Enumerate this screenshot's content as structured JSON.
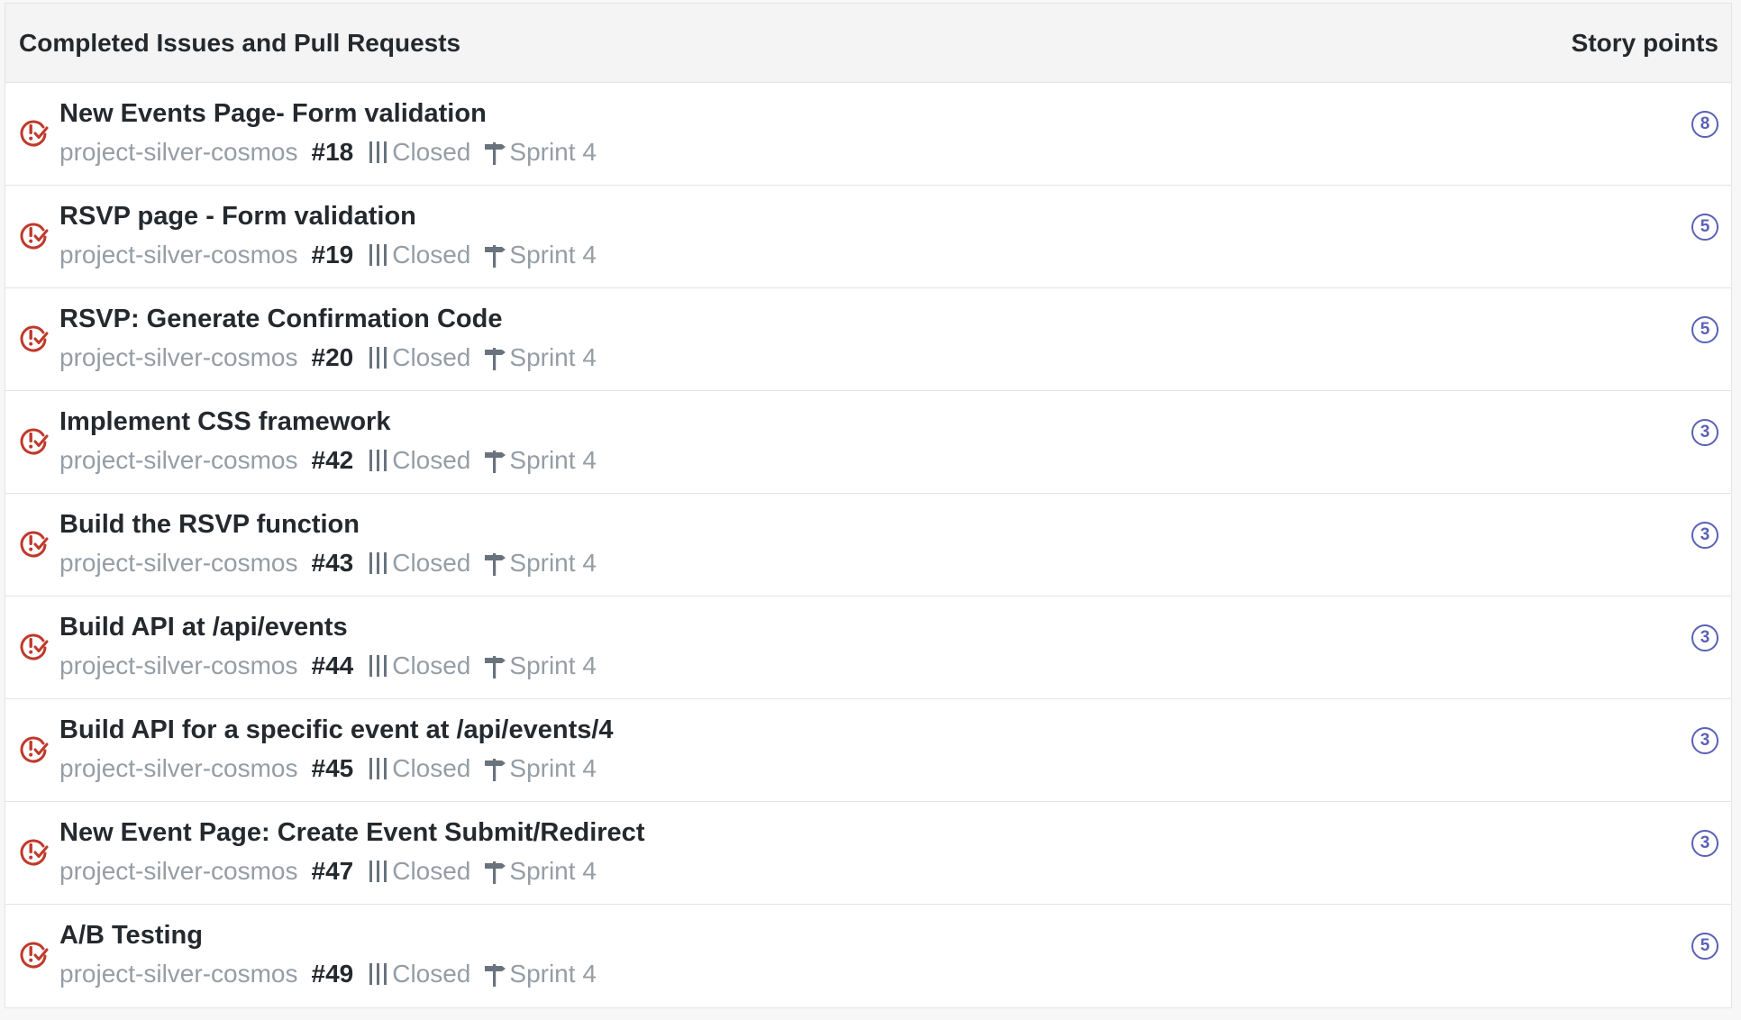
{
  "header": {
    "title": "Completed Issues and Pull Requests",
    "points_label": "Story points"
  },
  "colors": {
    "closed_icon": "#c0392b",
    "points_badge": "#5a61b6",
    "muted_text": "#959da5"
  },
  "issues": [
    {
      "title": "New Events Page- Form validation",
      "repo": "project-silver-cosmos",
      "number": "#18",
      "status": "Closed",
      "milestone": "Sprint 4",
      "points": "8"
    },
    {
      "title": "RSVP page - Form validation",
      "repo": "project-silver-cosmos",
      "number": "#19",
      "status": "Closed",
      "milestone": "Sprint 4",
      "points": "5"
    },
    {
      "title": "RSVP: Generate Confirmation Code",
      "repo": "project-silver-cosmos",
      "number": "#20",
      "status": "Closed",
      "milestone": "Sprint 4",
      "points": "5"
    },
    {
      "title": "Implement CSS framework",
      "repo": "project-silver-cosmos",
      "number": "#42",
      "status": "Closed",
      "milestone": "Sprint 4",
      "points": "3"
    },
    {
      "title": "Build the RSVP function",
      "repo": "project-silver-cosmos",
      "number": "#43",
      "status": "Closed",
      "milestone": "Sprint 4",
      "points": "3"
    },
    {
      "title": "Build API at /api/events",
      "repo": "project-silver-cosmos",
      "number": "#44",
      "status": "Closed",
      "milestone": "Sprint 4",
      "points": "3"
    },
    {
      "title": "Build API for a specific event at /api/events/4",
      "repo": "project-silver-cosmos",
      "number": "#45",
      "status": "Closed",
      "milestone": "Sprint 4",
      "points": "3"
    },
    {
      "title": "New Event Page: Create Event Submit/Redirect",
      "repo": "project-silver-cosmos",
      "number": "#47",
      "status": "Closed",
      "milestone": "Sprint 4",
      "points": "3"
    },
    {
      "title": "A/B Testing",
      "repo": "project-silver-cosmos",
      "number": "#49",
      "status": "Closed",
      "milestone": "Sprint 4",
      "points": "5"
    }
  ]
}
